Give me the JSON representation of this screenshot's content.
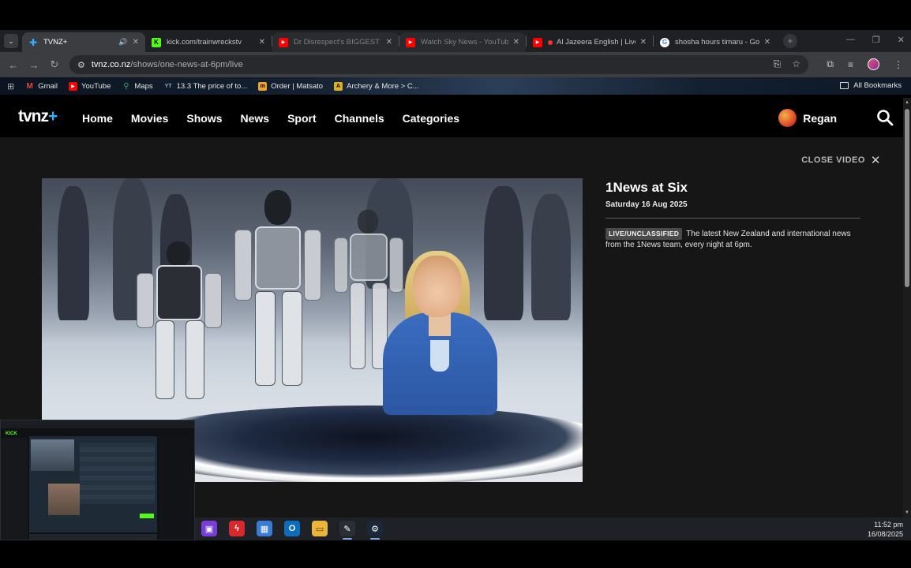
{
  "browser": {
    "tabs": [
      {
        "title": "TVNZ+",
        "active": true,
        "favicon": "tvnz-plus-icon",
        "audio": true
      },
      {
        "title": "kick.com/trainwreckstv",
        "active": false,
        "favicon": "kick-icon"
      },
      {
        "title": "Dr Disrespect's BIGGEST AI",
        "active": false,
        "favicon": "youtube-icon"
      },
      {
        "title": "Watch Sky News - YouTube",
        "active": false,
        "favicon": "youtube-icon"
      },
      {
        "title": "Al Jazeera English | Live",
        "active": false,
        "favicon": "youtube-icon"
      },
      {
        "title": "shosha hours timaru - Goog",
        "active": false,
        "favicon": "google-icon"
      }
    ],
    "url_host": "tvnz.co.nz",
    "url_path": "/shows/one-news-at-6pm/live",
    "bookmarks": [
      {
        "label": "Gmail",
        "icon": "gmail-icon",
        "color": "#ea4335"
      },
      {
        "label": "YouTube",
        "icon": "youtube-icon",
        "color": "#ff0000"
      },
      {
        "label": "Maps",
        "icon": "maps-icon",
        "color": "#34a853"
      },
      {
        "label": "13.3 The price of to...",
        "icon": "bookmark-icon",
        "color": "#5a5f66"
      },
      {
        "label": "Order | Matsato",
        "icon": "bookmark-icon",
        "color": "#f4a422"
      },
      {
        "label": "Archery & More > C...",
        "icon": "bookmark-icon",
        "color": "#e0b020"
      }
    ],
    "all_bookmarks": "All Bookmarks"
  },
  "site": {
    "logo_text": "tvnz",
    "logo_plus": "+",
    "nav": [
      "Home",
      "Movies",
      "Shows",
      "News",
      "Sport",
      "Channels",
      "Categories"
    ],
    "user_name": "Regan",
    "close_video": "CLOSE VIDEO"
  },
  "show": {
    "title": "1News at Six",
    "date": "Saturday 16 Aug 2025",
    "badge": "LIVE/UNCLASSIFIED",
    "description": "The latest New Zealand and international news from the 1News team, every night at 6pm."
  },
  "taskbar": {
    "time": "11:52 pm",
    "date": "16/08/2025",
    "icons": [
      "twitch-icon",
      "lightning-app-icon",
      "microsoft-store-icon",
      "outlook-icon",
      "file-explorer-icon",
      "tool-icon",
      "steam-icon"
    ]
  },
  "pip": {
    "logo": "KICK"
  }
}
